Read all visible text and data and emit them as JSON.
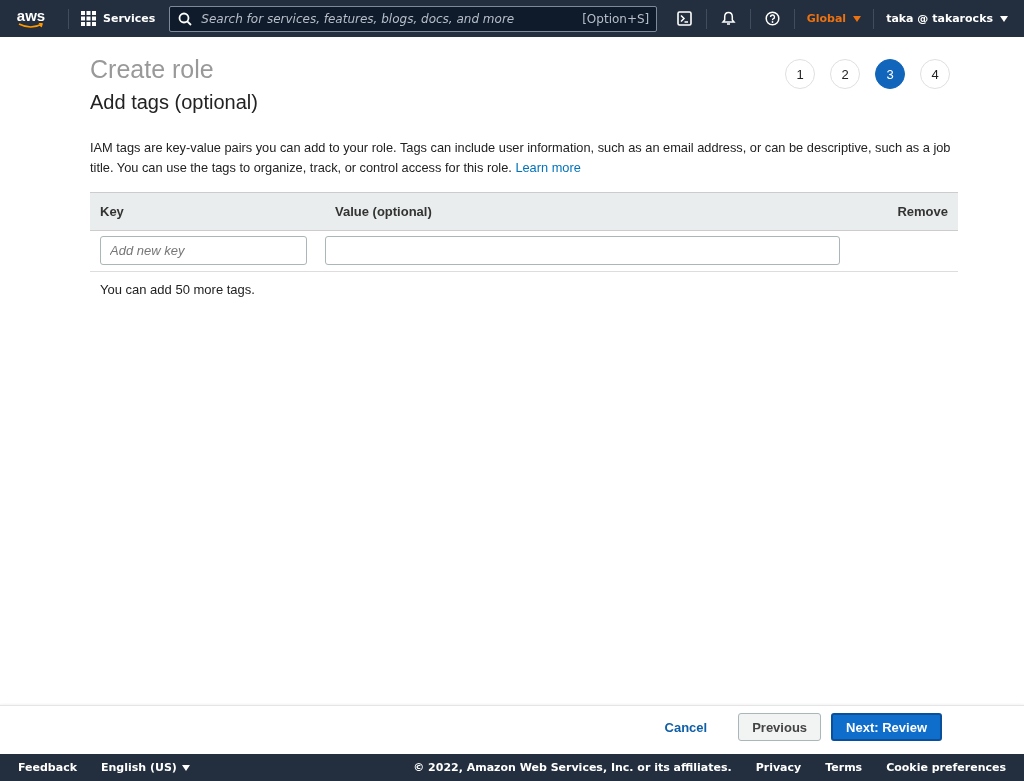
{
  "nav": {
    "logo": "aws",
    "services": "Services",
    "search": {
      "placeholder": "Search for services, features, blogs, docs, and more",
      "shortcut": "[Option+S]"
    },
    "region": "Global",
    "account": "taka @ takarocks"
  },
  "page": {
    "title": "Create role",
    "steps": [
      {
        "label": "1",
        "selected": false
      },
      {
        "label": "2",
        "selected": false
      },
      {
        "label": "3",
        "selected": true
      },
      {
        "label": "4",
        "selected": false
      }
    ],
    "heading": "Add tags (optional)",
    "description": "IAM tags are key-value pairs you can add to your role. Tags can include user information, such as an email address, or can be descriptive, such as a job title. You can use the tags to organize, track, or control access for this role.",
    "learn_more": "Learn more",
    "table": {
      "columns": [
        "Key",
        "Value (optional)",
        "Remove"
      ],
      "rows": [
        {
          "key": {
            "placeholder": "Add new key"
          }
        }
      ]
    },
    "remaining": "You can add 50 more tags."
  },
  "actions": {
    "cancel": "Cancel",
    "previous": "Previous",
    "next": "Next: Review"
  },
  "footer": {
    "feedback": "Feedback",
    "language": "English (US)",
    "copyright": "© 2022, Amazon Web Services, Inc. or its affiliates.",
    "links": [
      "Privacy",
      "Terms",
      "Cookie preferences"
    ]
  }
}
